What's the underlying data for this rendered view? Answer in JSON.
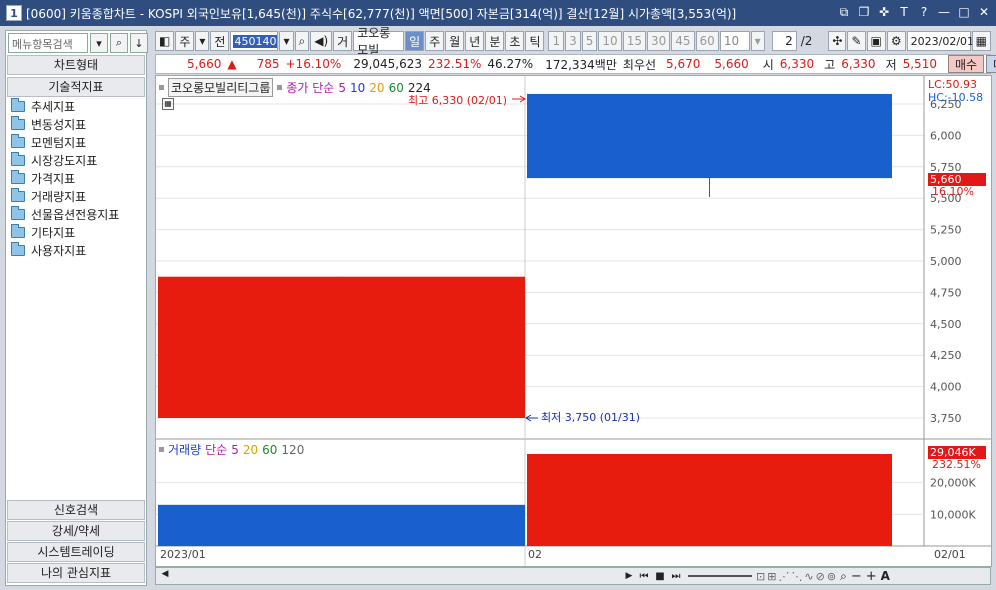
{
  "window": {
    "icon_label": "1",
    "title": "[0600] 키움종합차트 - KOSPI 외국인보유[1,645(천)] 주식수[62,777(천)] 액면[500] 자본금[314(억)] 결산[12월] 시가총액[3,553(억)]"
  },
  "left_panel": {
    "search_placeholder": "메뉴항목검색",
    "chart_type_header": "차트형태",
    "indicator_header": "기술적지표",
    "tree": [
      "추세지표",
      "변동성지표",
      "모멘텀지표",
      "시장강도지표",
      "가격지표",
      "거래량지표",
      "선물옵션전용지표",
      "기타지표",
      "사용자지표"
    ],
    "bottom_buttons": [
      "신호검색",
      "강세/약세",
      "시스템트레이딩",
      "나의 관심지표"
    ]
  },
  "toolbar": {
    "week_label": "주",
    "prev_label": "전",
    "code": "450140",
    "go_label": "거",
    "stock_name": "코오롱모빌",
    "periods": [
      "일",
      "주",
      "월",
      "년",
      "분",
      "초",
      "틱"
    ],
    "selected_period": "일",
    "intervals": [
      "1",
      "3",
      "5",
      "10",
      "15",
      "30",
      "45",
      "60"
    ],
    "count": "10",
    "page": "2",
    "page_total": "/2",
    "date": "2023/02/01"
  },
  "infobar": {
    "price": "5,660",
    "change": "785",
    "change_pct": "+16.10%",
    "volume": "29,045,623",
    "volume_pct": "232.51%",
    "turnover": "46.27%",
    "amount": "172,334백만",
    "best_bid_label": "최우선",
    "best_ask": "5,670",
    "best_bid": "5,660",
    "open_label": "시",
    "open": "6,330",
    "high_label": "고",
    "high": "6,330",
    "low_label": "저",
    "low": "5,510",
    "buy_label": "매수",
    "sell_label": "매도"
  },
  "chart": {
    "price_legend": {
      "name": "코오롱모빌리티그룹",
      "ma_label": "종가 단순",
      "ma": [
        "5",
        "10",
        "20",
        "60",
        "224"
      ]
    },
    "volume_legend": {
      "name": "거래량",
      "ma_label": "단순",
      "ma": [
        "5",
        "20",
        "60",
        "120"
      ]
    },
    "lc_label": "LC:50.93",
    "hc_label": "HC:-10.58",
    "high_annotation": "최고 6,330 (02/01)",
    "low_annotation": "최저 3,750 (01/31)",
    "current_price_tag": "5,660",
    "current_pct_tag": "16.10%",
    "volume_tag": "29,046K",
    "volume_pct_tag": "232.51%",
    "x_labels": [
      "2023/01",
      "02"
    ],
    "x_right_label": "02/01",
    "colors": {
      "up": "#e81c0e",
      "down": "#1a5fce"
    }
  },
  "chart_data": {
    "type": "candlestick",
    "price_axis_ticks": [
      "6,250",
      "6,000",
      "5,750",
      "5,500",
      "5,250",
      "5,000",
      "4,750",
      "4,500",
      "4,250",
      "4,000",
      "3,750"
    ],
    "volume_axis_ticks": [
      "20,000K",
      "10,000K"
    ],
    "candles": [
      {
        "date": "2023/01/31",
        "open": 4875,
        "high": 4875,
        "low": 3750,
        "close": 3750,
        "color": "up"
      },
      {
        "date": "2023/02/01",
        "open": 6330,
        "high": 6330,
        "low": 5510,
        "close": 5660,
        "color": "down"
      }
    ],
    "volume": [
      {
        "date": "2023/01/31",
        "value": 13000,
        "unit": "K",
        "color": "down"
      },
      {
        "date": "2023/02/01",
        "value": 29046,
        "unit": "K",
        "color": "up"
      }
    ]
  }
}
